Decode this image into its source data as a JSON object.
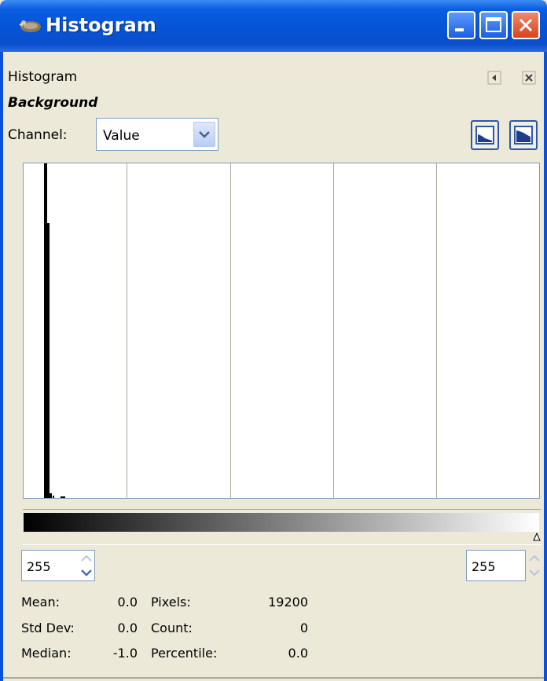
{
  "window": {
    "title": "Histogram",
    "icon": "gimp-wilber-icon"
  },
  "dock": {
    "tab_title": "Histogram",
    "layer_name": "Background",
    "menu_icon": "tab-menu-arrow-icon",
    "close_icon": "close-dock-icon"
  },
  "channel": {
    "label": "Channel:",
    "selected": "Value"
  },
  "histogram": {
    "range_start": "255",
    "range_end": "255",
    "mode_buttons": [
      "linear-histogram-icon",
      "logarithmic-histogram-icon"
    ]
  },
  "stats": {
    "mean_label": "Mean:",
    "mean_value": "0.0",
    "std_label": "Std Dev:",
    "std_value": "0.0",
    "median_label": "Median:",
    "median_value": "-1.0",
    "pixels_label": "Pixels:",
    "pixels_value": "19200",
    "count_label": "Count:",
    "count_value": "0",
    "percentile_label": "Percentile:",
    "percentile_value": "0.0"
  }
}
